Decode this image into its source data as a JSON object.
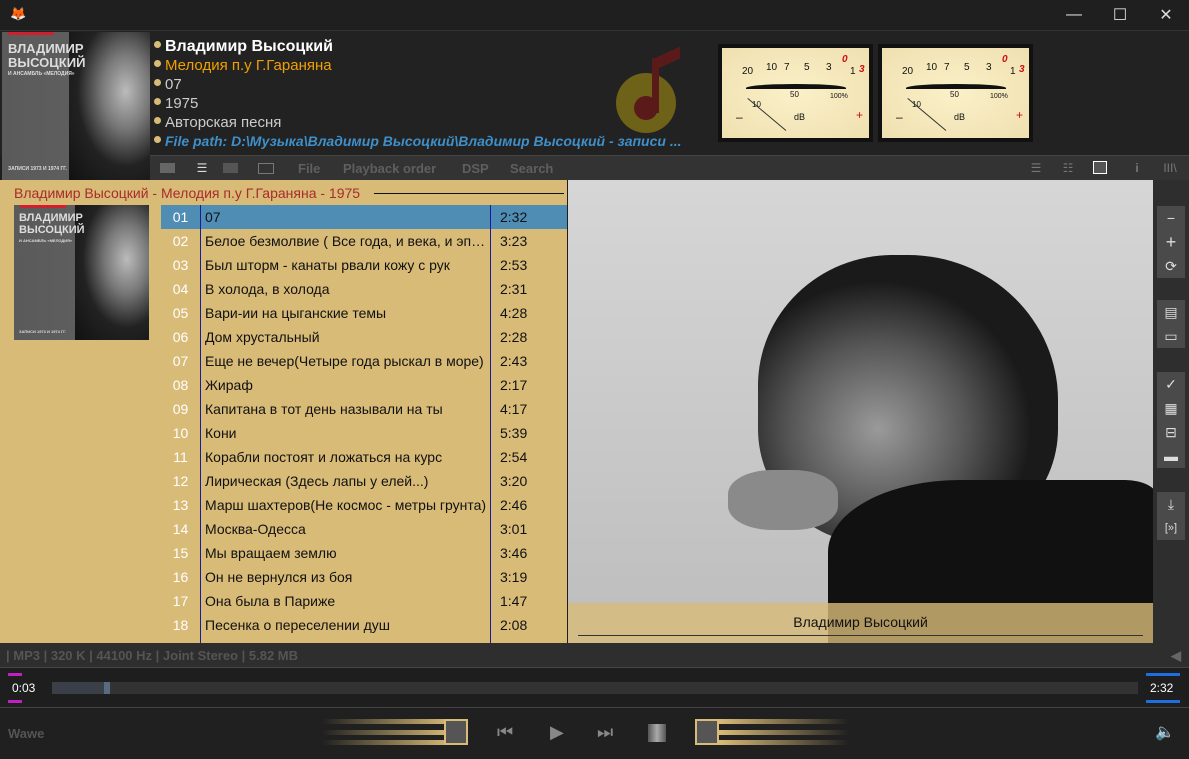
{
  "window": {
    "minimize": "—",
    "maximize": "☐",
    "close": "✕"
  },
  "cover": {
    "line1": "ВЛАДИМИР",
    "line2": "ВЫСОЦКИЙ",
    "line3": "И АНСАМБЛЬ «МЕЛОДИЯ»",
    "line4": "ЗАПИСИ 1973 И 1974 ГГ."
  },
  "info": {
    "artist": "Владимир Высоцкий",
    "album": "Мелодия п.у Г.Гараняна",
    "track": "07",
    "year": "1975",
    "genre": "Авторская песня",
    "file_path": "File path: D:\\Музыка\\Владимир Высоцкий\\Владимир Высоцкий - записи ..."
  },
  "vu": {
    "scale": [
      "20",
      "10",
      "7",
      "5",
      "3",
      "1"
    ],
    "red": [
      "0",
      "3"
    ],
    "inner_left": "10",
    "inner_mid": "50",
    "inner_right": "100%",
    "unit": "dB",
    "minus": "–",
    "plus": "+"
  },
  "menu": [
    "File",
    "Playback order",
    "DSP",
    "Search"
  ],
  "playlist": {
    "group": "Владимир Высоцкий - Мелодия п.у Г.Гараняна - 1975",
    "tracks": [
      {
        "n": "01",
        "title": "07",
        "dur": "2:32"
      },
      {
        "n": "02",
        "title": "Белое безмолвие ( Все года, и века, и эпохи подряд)",
        "dur": "3:23"
      },
      {
        "n": "03",
        "title": "Был шторм - канаты рвали кожу с рук",
        "dur": "2:53"
      },
      {
        "n": "04",
        "title": "В холода, в холода",
        "dur": "2:31"
      },
      {
        "n": "05",
        "title": "Вари-ии на цыганские темы",
        "dur": "4:28"
      },
      {
        "n": "06",
        "title": "Дом хрустальный",
        "dur": "2:28"
      },
      {
        "n": "07",
        "title": "Еще не вечер(Четыре года рыскал в море)",
        "dur": "2:43"
      },
      {
        "n": "08",
        "title": "Жираф",
        "dur": "2:17"
      },
      {
        "n": "09",
        "title": "Капитана в тот день называли на ты",
        "dur": "4:17"
      },
      {
        "n": "10",
        "title": "Кони",
        "dur": "5:39"
      },
      {
        "n": "11",
        "title": "Корабли постоят и ложаться на курс",
        "dur": "2:54"
      },
      {
        "n": "12",
        "title": "Лирическая (Здесь лапы у елей...)",
        "dur": "3:20"
      },
      {
        "n": "13",
        "title": "Марш шахтеров(Не космос - метры грунта)",
        "dur": "2:46"
      },
      {
        "n": "14",
        "title": "Москва-Одесса",
        "dur": "3:01"
      },
      {
        "n": "15",
        "title": "Мы вращаем землю",
        "dur": "3:46"
      },
      {
        "n": "16",
        "title": "Он не вернулся из боя",
        "dur": "3:19"
      },
      {
        "n": "17",
        "title": "Она была в Париже",
        "dur": "1:47"
      },
      {
        "n": "18",
        "title": "Песенка о переселении душ",
        "dur": "2:08"
      }
    ]
  },
  "photo_caption": "Владимир Высоцкий",
  "status": "| MP3 | 320 K | 44100 Hz | Joint Stereo | 5.82 MB",
  "seek": {
    "elapsed": "0:03",
    "total": "2:32",
    "progress": 0.02
  },
  "controls": {
    "label": "Wawe"
  },
  "colors": {
    "accent": "#d9bb78",
    "selection": "#4f8db5",
    "group_title": "#a82c2c",
    "album": "#f0a000",
    "file_path": "#3f8fc8"
  }
}
